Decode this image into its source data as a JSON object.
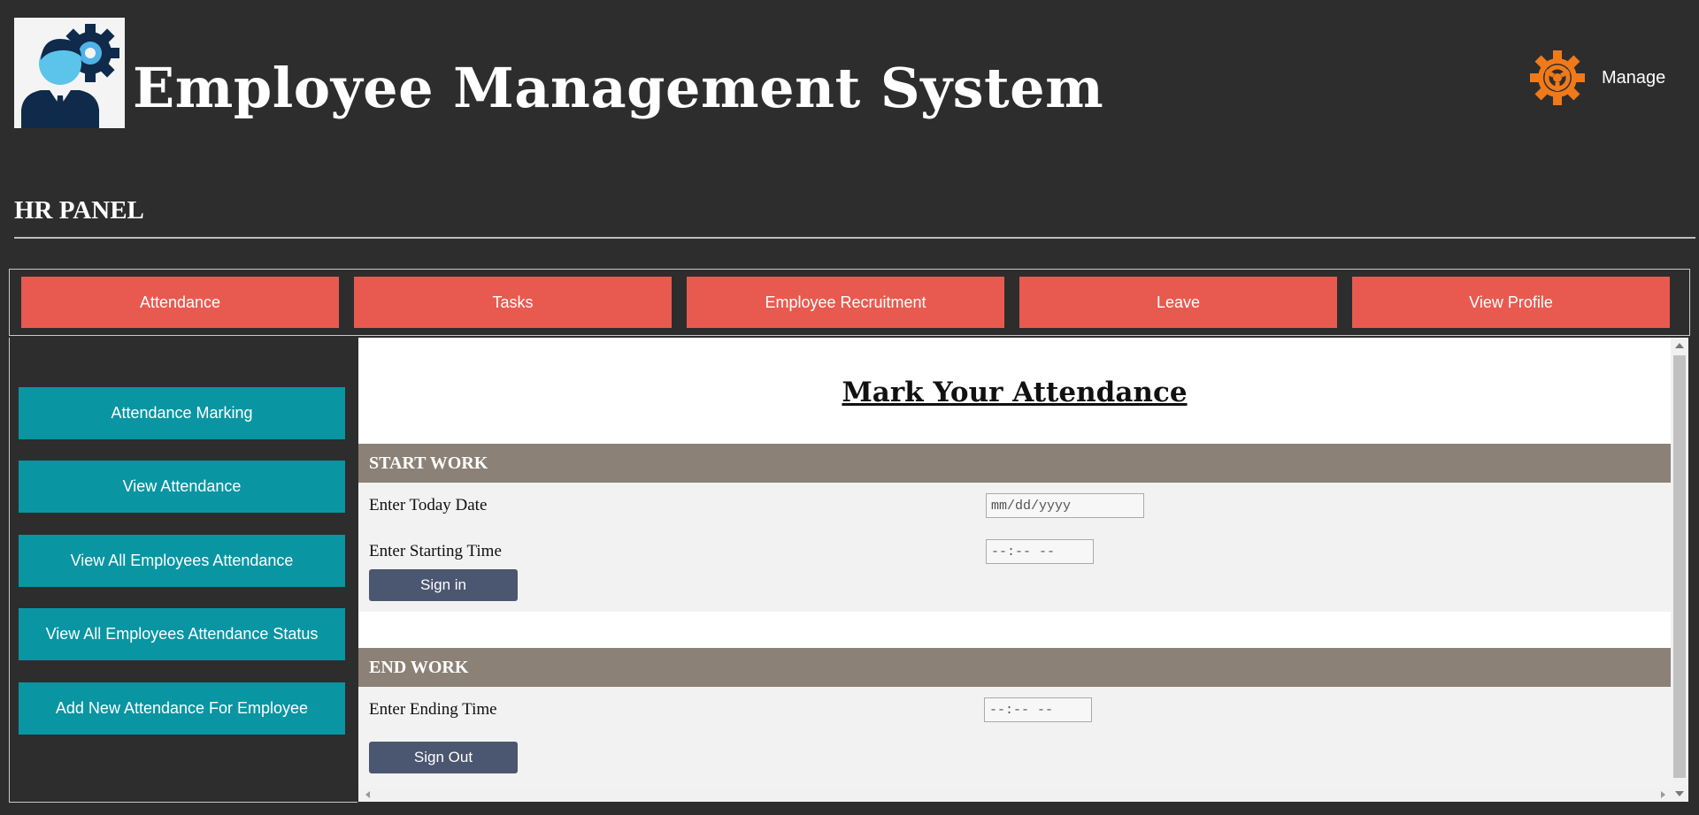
{
  "header": {
    "title": "Employee Management System",
    "logo_icon": "employee-gear-logo-icon",
    "manage_icon": "gear-icon",
    "manage_label": "Manage"
  },
  "panel": {
    "title": "HR PANEL"
  },
  "tabs": [
    {
      "label": "Attendance"
    },
    {
      "label": "Tasks"
    },
    {
      "label": "Employee Recruitment"
    },
    {
      "label": "Leave"
    },
    {
      "label": "View Profile"
    }
  ],
  "sidebar": {
    "items": [
      {
        "label": "Attendance Marking"
      },
      {
        "label": "View Attendance"
      },
      {
        "label": "View All Employees Attendance"
      },
      {
        "label": "View All Employees Attendance Status"
      },
      {
        "label": "Add New Attendance For Employee"
      }
    ]
  },
  "main": {
    "title": "Mark Your Attendance",
    "start_work": {
      "heading": "START WORK",
      "date_label": "Enter Today Date",
      "date_placeholder": "mm/dd/yyyy",
      "start_time_label": "Enter Starting Time",
      "time_placeholder": "--:-- --",
      "sign_in_label": "Sign in"
    },
    "end_work": {
      "heading": "END WORK",
      "end_time_label": "Enter Ending Time",
      "time_placeholder": "--:-- --",
      "sign_out_label": "Sign Out"
    }
  },
  "colors": {
    "page_background": "#2d2d2d",
    "tab_background": "#e85a4f",
    "sidebar_button_background": "#0a95a3",
    "section_header_background": "#8b8176",
    "action_button_background": "#4b5670",
    "gear_accent": "#f07a1a"
  }
}
